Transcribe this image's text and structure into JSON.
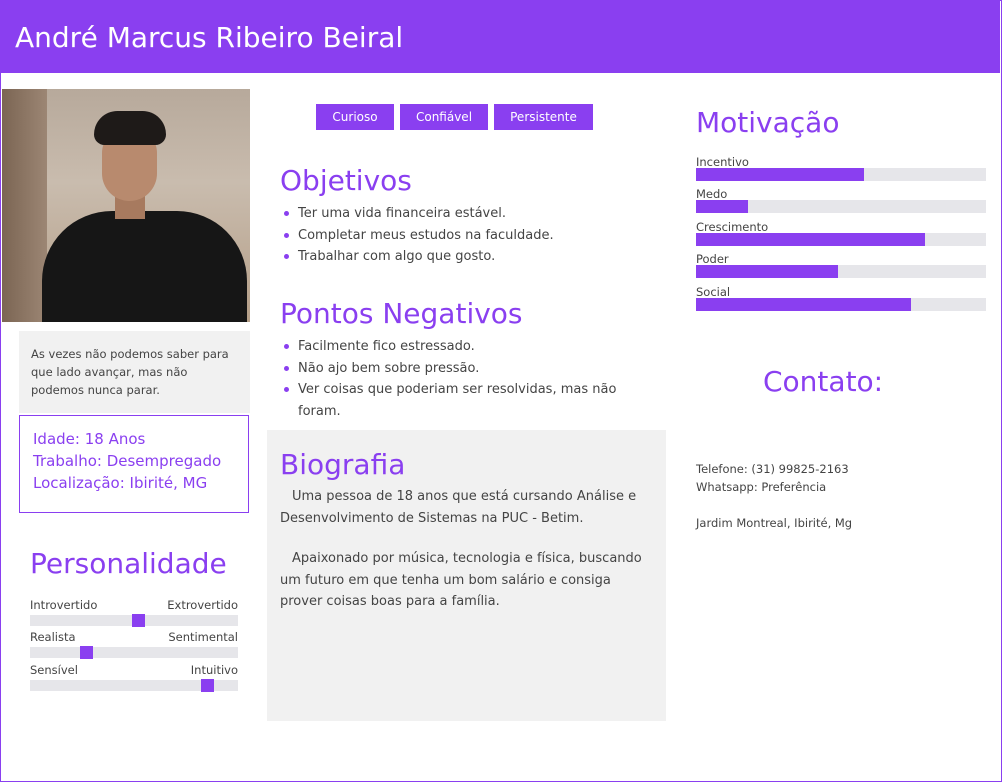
{
  "header": {
    "name": "André Marcus Ribeiro Beiral"
  },
  "profile": {
    "quote": "As vezes não podemos saber para que lado avançar, mas não podemos nunca parar.",
    "age": "Idade: 18 Anos",
    "job": "Trabalho: Desempregado",
    "location": "Localização: Ibirité, MG"
  },
  "personality": {
    "title": "Personalidade",
    "scales": [
      {
        "left": "Introvertido",
        "right": "Extrovertido",
        "value": 0.52
      },
      {
        "left": "Realista",
        "right": "Sentimental",
        "value": 0.27
      },
      {
        "left": "Sensível",
        "right": "Intuitivo",
        "value": 0.85
      }
    ]
  },
  "tags": [
    "Curioso",
    "Confiável",
    "Persistente"
  ],
  "goals": {
    "title": "Objetivos",
    "items": [
      "Ter uma vida financeira estável.",
      "Completar meus estudos na faculdade.",
      "Trabalhar com algo que gosto."
    ]
  },
  "negatives": {
    "title": "Pontos Negativos",
    "items": [
      "Facilmente fico estressado.",
      "Não ajo bem sobre pressão.",
      "Ver coisas que poderiam ser resolvidas, mas não foram."
    ]
  },
  "bio": {
    "title": "Biografia",
    "paragraphs": [
      "Uma pessoa de 18 anos que está cursando Análise e Desenvolvimento de Sistemas na PUC - Betim.",
      "Apaixonado por música, tecnologia e física, buscando um futuro em que tenha um bom salário e consiga prover coisas boas para a família."
    ]
  },
  "motivation": {
    "title": "Motivação",
    "items": [
      {
        "label": "Incentivo",
        "value": 0.58
      },
      {
        "label": "Medo",
        "value": 0.18
      },
      {
        "label": "Crescimento",
        "value": 0.79
      },
      {
        "label": "Poder",
        "value": 0.49
      },
      {
        "label": "Social",
        "value": 0.74
      }
    ]
  },
  "contact": {
    "title": "Contato:",
    "phone": "Telefone: (31) 99825-2163",
    "whatsapp": "Whatsapp: Preferência",
    "address": "Jardim Montreal, Ibirité, Mg"
  },
  "colors": {
    "accent": "#8a3ff0",
    "panel": "#f1f1f1",
    "track": "#e6e6ea"
  },
  "icons": {
    "photo": "profile-photo"
  }
}
